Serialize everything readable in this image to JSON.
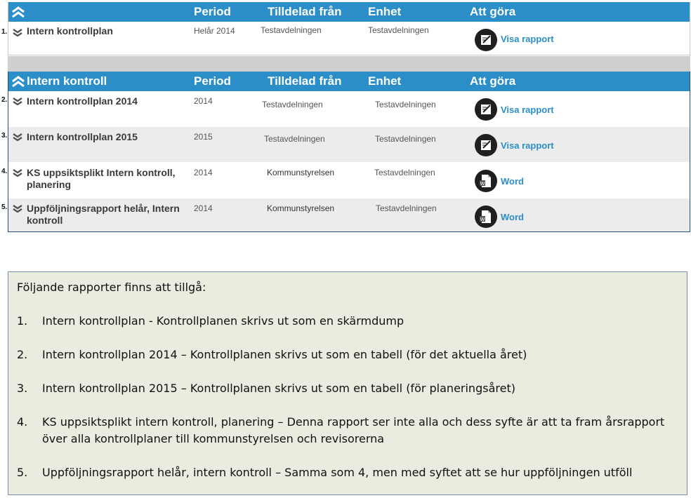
{
  "panel1": {
    "headers": {
      "period": "Period",
      "from": "Tilldelad från",
      "unit": "Enhet",
      "todo": "Att göra"
    },
    "rows": [
      {
        "num": "1.",
        "title": "Intern kontrollplan",
        "period": "Helår 2014",
        "from": "Testavdelningen",
        "unit": "Testavdelningen",
        "action": "Visa rapport",
        "icon": "edit-icon"
      }
    ]
  },
  "panel2": {
    "headers": {
      "title": "Intern kontroll",
      "period": "Period",
      "from": "Tilldelad från",
      "unit": "Enhet",
      "todo": "Att göra"
    },
    "rows": [
      {
        "num": "2.",
        "title": "Intern kontrollplan 2014",
        "period": "2014",
        "from": "Testavdelningen",
        "unit": "Testavdelningen",
        "action": "Visa rapport",
        "icon": "edit-icon"
      },
      {
        "num": "3.",
        "title": "Intern kontrollplan 2015",
        "period": "2015",
        "from": "Testavdelningen",
        "unit": "Testavdelningen",
        "action": "Visa rapport",
        "icon": "edit-icon"
      },
      {
        "num": "4.",
        "title": "KS uppsiktsplikt Intern kontroll, planering",
        "period": "2014",
        "from": "Kommunstyrelsen",
        "unit": "Testavdelningen",
        "action": "Word",
        "icon": "word-doc-icon"
      },
      {
        "num": "5.",
        "title": "Uppföljningsrapport helår, Intern kontroll",
        "period": "2014",
        "from": "Kommunstyrelsen",
        "unit": "Testavdelningen",
        "action": "Word",
        "icon": "word-doc-icon"
      }
    ]
  },
  "notes": {
    "intro": "Följande rapporter finns att tillgå:",
    "items": [
      {
        "n": "1.",
        "text": "Intern kontrollplan -  Kontrollplanen skrivs ut som en skärmdump"
      },
      {
        "n": "2.",
        "text": "Intern kontrollplan 2014 – Kontrollplanen skrivs ut som en tabell (för det aktuella året)"
      },
      {
        "n": "3.",
        "text": "Intern kontrollplan 2015 – Kontrollplanen skrivs ut som en tabell (för planeringsåret)"
      },
      {
        "n": "4.",
        "text": "KS uppsiktsplikt intern kontroll, planering – Denna rapport ser inte alla och dess syfte är att ta fram årsrapport över alla kontrollplaner till kommunstyrelsen och revisorerna"
      },
      {
        "n": "5.",
        "text": "Uppföljningsrapport helår, intern kontroll – Samma som 4, men med syftet att se hur uppföljningen utföll"
      }
    ]
  },
  "colors": {
    "header": "#2b8ec9",
    "link": "#2b8ec9",
    "alt_row": "#ececec",
    "notes_bg": "#ecebe0"
  }
}
